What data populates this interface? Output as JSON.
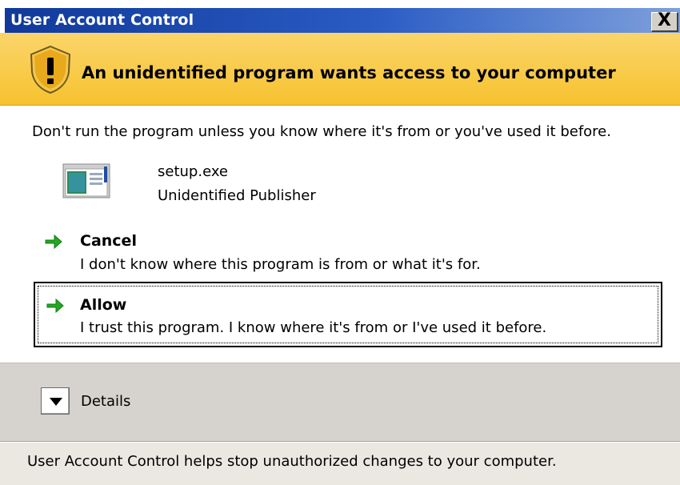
{
  "window": {
    "title": "User Account Control",
    "close_label": "X"
  },
  "banner": {
    "text": "An unidentified program wants access to your computer"
  },
  "warning": {
    "text": "Don't run the program unless you know where it's from or you've used it before."
  },
  "program": {
    "name": "setup.exe",
    "publisher": "Unidentified Publisher"
  },
  "options": [
    {
      "label": "Cancel",
      "description": "I don't know where this program is from or what it's for."
    },
    {
      "label": "Allow",
      "description": "I trust this program. I know where it's from or I've used it before."
    }
  ],
  "details": {
    "label": "Details"
  },
  "footer": {
    "text": "User Account Control helps stop unauthorized changes to your computer."
  },
  "colors": {
    "titlebar": "#10399a",
    "banner": "#f6c22f",
    "arrow": "#22a822",
    "details_bg": "#d6d3ce"
  },
  "icons": {
    "banner": "shield-warning-icon",
    "program": "program-icon",
    "option": "green-arrow-icon",
    "details": "chevron-down-icon"
  }
}
